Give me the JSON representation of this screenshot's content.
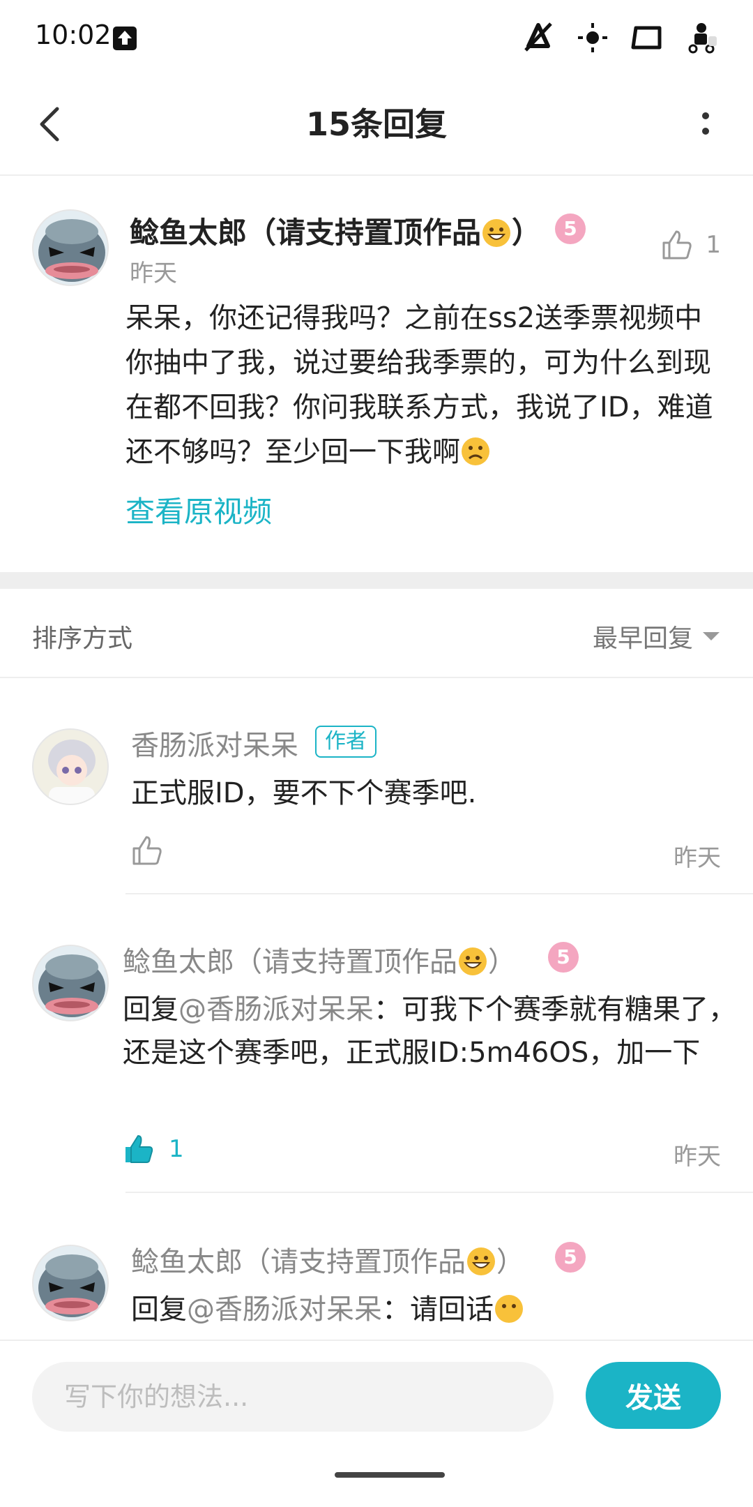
{
  "status_bar": {
    "time": "10:02",
    "icons": [
      "upload-icon",
      "notifications-off-icon",
      "brightness-icon",
      "screen-icon",
      "delivery-scooter-icon"
    ]
  },
  "top_bar": {
    "title": "15条回复",
    "back_icon": "back-arrow-icon",
    "more_icon": "more-vertical-icon"
  },
  "main_comment": {
    "author": "鲶鱼太郎（请支持置顶作品",
    "author_suffix": "）",
    "level": "5",
    "time": "昨天",
    "like_count": "1",
    "text": "呆呆，你还记得我吗？之前在ss2送季票视频中你抽中了我，说过要给我季票的，可为什么到现在都不回我？你问我联系方式，我说了ID，难道还不够吗？至少回一下我啊",
    "link": "查看原视频"
  },
  "sort": {
    "label": "排序方式",
    "value": "最早回复"
  },
  "replies": [
    {
      "author": "香肠派对呆呆",
      "tag": "作者",
      "text": "正式服ID，要不下个赛季吧.",
      "time": "昨天",
      "liked": false,
      "like_count": ""
    },
    {
      "author": "鲶鱼太郎（请支持置顶作品",
      "author_suffix": "）",
      "level": "5",
      "reply_prefix": "回复",
      "mention": "@香肠派对呆呆",
      "text": "：可我下个赛季就有糖果了，还是这个赛季吧，正式服ID:5m46OS，加一下",
      "time": "昨天",
      "liked": true,
      "like_count": "1"
    },
    {
      "author": "鲶鱼太郎（请支持置顶作品",
      "author_suffix": "）",
      "level": "5",
      "reply_prefix": "回复",
      "mention": "@香肠派对呆呆",
      "text": "：请回话"
    }
  ],
  "input": {
    "placeholder": "写下你的想法...",
    "send_label": "发送"
  },
  "colors": {
    "accent": "#1bb4c6",
    "level_badge": "#f4a6c0",
    "muted_text": "#999999",
    "divider": "#eeeeee"
  }
}
